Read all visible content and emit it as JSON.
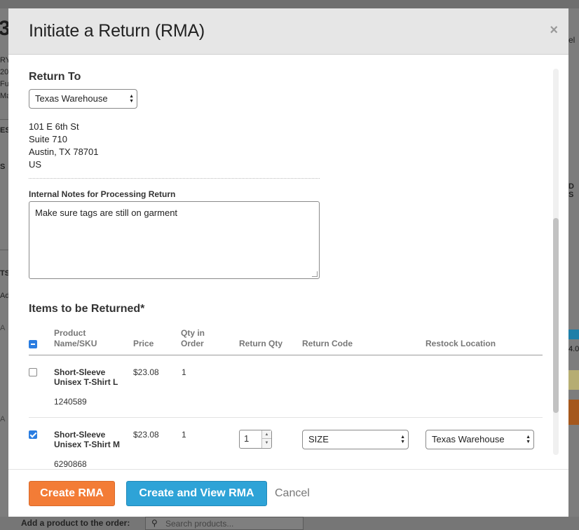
{
  "modal": {
    "title": "Initiate a Return (RMA)",
    "close_glyph": "×"
  },
  "return_to": {
    "heading": "Return To",
    "selected_location": "Texas Warehouse",
    "address_lines": [
      "101 E 6th St",
      "Suite 710",
      "Austin, TX 78701",
      "US"
    ]
  },
  "notes": {
    "label": "Internal Notes for Processing Return",
    "value": "Make sure tags are still on garment"
  },
  "items": {
    "heading": "Items to be Returned*",
    "columns": {
      "product": "Product Name/SKU",
      "price": "Price",
      "qty_in_order": "Qty in Order",
      "return_qty": "Return Qty",
      "return_code": "Return Code",
      "restock_location": "Restock Location"
    },
    "rows": [
      {
        "checked": false,
        "name": "Short-Sleeve Unisex T-Shirt L",
        "sku": "1240589",
        "price": "$23.08",
        "qty_in_order": "1"
      },
      {
        "checked": true,
        "name": "Short-Sleeve Unisex T-Shirt M",
        "sku": "6290868",
        "price": "$23.08",
        "qty_in_order": "1",
        "return_qty": "1",
        "return_code": "SIZE",
        "restock_location": "Texas Warehouse"
      }
    ]
  },
  "footer": {
    "create_rma": "Create RMA",
    "create_and_view_rma": "Create and View RMA",
    "cancel": "Cancel"
  },
  "background": {
    "add_product_label": "Add a product to the order:",
    "search_placeholder": "Search products..."
  },
  "colors": {
    "orange_button": "#f37c36",
    "blue_button": "#2ea3d7",
    "checkbox_blue": "#2a7de1",
    "header_bg": "#e6e6e6"
  }
}
